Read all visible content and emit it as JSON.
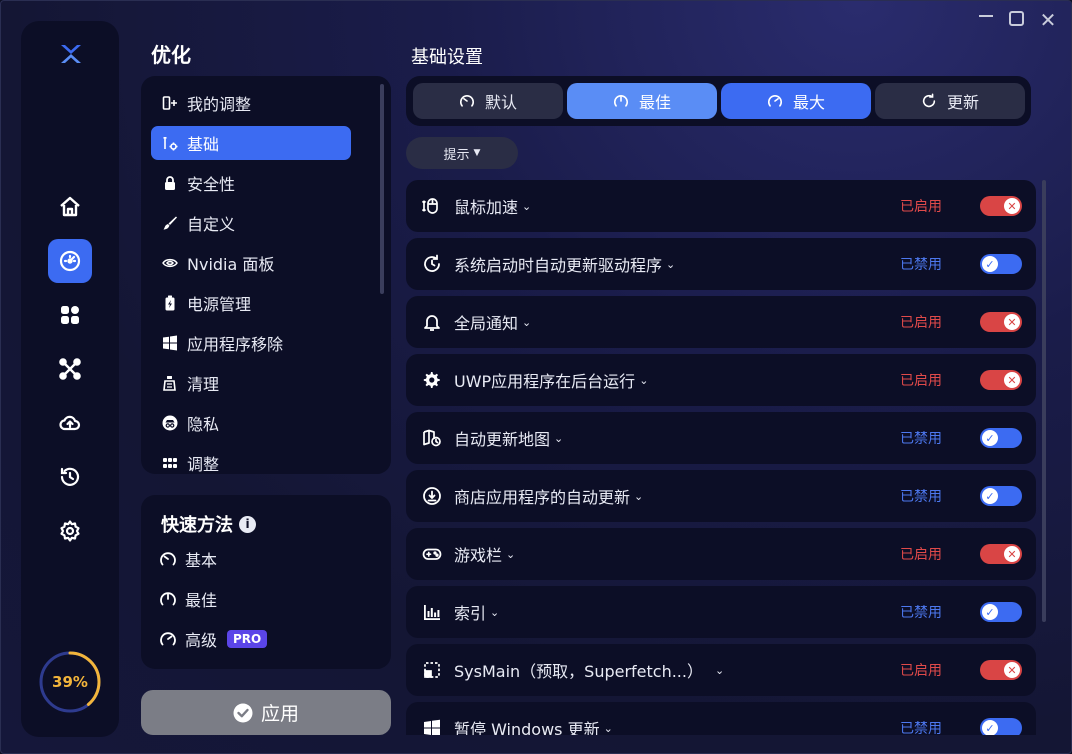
{
  "window": {
    "controls": [
      "minimize",
      "maximize",
      "close"
    ]
  },
  "rail": {
    "logo": "x-logo-icon",
    "nav": [
      {
        "icon": "home-icon"
      },
      {
        "icon": "speedometer-icon",
        "active": true
      },
      {
        "icon": "apps-grid-icon"
      },
      {
        "icon": "network-nodes-icon"
      },
      {
        "icon": "cloud-upload-icon"
      },
      {
        "icon": "history-restore-icon"
      },
      {
        "icon": "settings-gear-icon"
      }
    ],
    "gauge": {
      "value": 39,
      "label": "39%"
    }
  },
  "optimize": {
    "title": "优化",
    "items": [
      {
        "label": "我的调整",
        "icon": "list-add-icon"
      },
      {
        "label": "基础",
        "icon": "tools-icon",
        "active": true
      },
      {
        "label": "安全性",
        "icon": "lock-icon"
      },
      {
        "label": "自定义",
        "icon": "brush-icon"
      },
      {
        "label": "Nvidia 面板",
        "icon": "nvidia-eye-icon"
      },
      {
        "label": "电源管理",
        "icon": "battery-icon"
      },
      {
        "label": "应用程序移除",
        "icon": "windows-icon"
      },
      {
        "label": "清理",
        "icon": "clean-icon"
      },
      {
        "label": "隐私",
        "icon": "privacy-icon"
      },
      {
        "label": "调整",
        "icon": "dots-grid-icon"
      }
    ]
  },
  "quick": {
    "title": "快速方法",
    "items": [
      {
        "label": "基本",
        "icon": "speed-low-icon"
      },
      {
        "label": "最佳",
        "icon": "speed-mid-icon"
      },
      {
        "label": "高级",
        "icon": "speed-high-icon",
        "badge": "PRO"
      }
    ]
  },
  "apply": {
    "label": "应用"
  },
  "basic": {
    "title": "基础设置",
    "presets": [
      {
        "label": "默认",
        "icon": "speed-low-icon"
      },
      {
        "label": "最佳",
        "icon": "speed-mid-icon"
      },
      {
        "label": "最大",
        "icon": "speed-high-icon"
      },
      {
        "label": "更新",
        "icon": "refresh-icon"
      }
    ],
    "tips": "提示",
    "settings": [
      {
        "label": "鼠标加速",
        "icon": "mouse-icon",
        "status": "已启用",
        "enabled": true
      },
      {
        "label": "系统启动时自动更新驱动程序",
        "icon": "sync-icon",
        "status": "已禁用",
        "enabled": false
      },
      {
        "label": "全局通知",
        "icon": "bell-icon",
        "status": "已启用",
        "enabled": true
      },
      {
        "label": "UWP应用程序在后台运行",
        "icon": "gear-sync-icon",
        "status": "已启用",
        "enabled": true
      },
      {
        "label": "自动更新地图",
        "icon": "map-icon",
        "status": "已禁用",
        "enabled": false
      },
      {
        "label": "商店应用程序的自动更新",
        "icon": "download-icon",
        "status": "已禁用",
        "enabled": false
      },
      {
        "label": "游戏栏",
        "icon": "gamepad-icon",
        "status": "已启用",
        "enabled": true
      },
      {
        "label": "索引",
        "icon": "index-chart-icon",
        "status": "已禁用",
        "enabled": false
      },
      {
        "label": "SysMain（预取，Superfetch...）",
        "icon": "select-box-icon",
        "status": "已启用",
        "enabled": true
      },
      {
        "label": "暂停 Windows 更新",
        "icon": "windows-icon",
        "status": "已禁用",
        "enabled": false
      }
    ]
  },
  "colors": {
    "accent": "#3c6bf2",
    "accent_light": "#5a8df5",
    "enabled_red": "#d94545",
    "disabled_blue": "#4d78ef",
    "gauge_orange": "#f3b53b"
  }
}
